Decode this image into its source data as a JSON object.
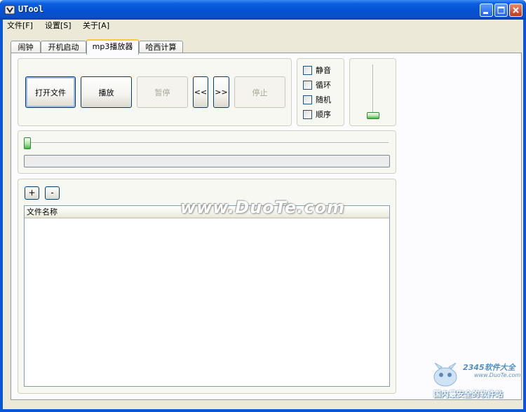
{
  "window": {
    "title": "UTool"
  },
  "menu": [
    {
      "label": "文件[F]"
    },
    {
      "label": "设置[S]"
    },
    {
      "label": "关于[A]"
    }
  ],
  "tabs": [
    {
      "label": "闹钟"
    },
    {
      "label": "开机启动"
    },
    {
      "label": "mp3播放器",
      "active": true
    },
    {
      "label": "哈西计算"
    }
  ],
  "player": {
    "open_file": "打开文件",
    "play": "播放",
    "pause": "暂停",
    "prev": "<<",
    "next": ">>",
    "stop": "停止",
    "options": [
      {
        "label": "静音",
        "checked": false
      },
      {
        "label": "循环",
        "checked": false
      },
      {
        "label": "随机",
        "checked": false
      },
      {
        "label": "顺序",
        "checked": false
      }
    ],
    "volume_level": 0,
    "seek_position": 0,
    "progress": 0
  },
  "playlist": {
    "add": "+",
    "remove": "-",
    "column_header": "文件名称",
    "items": []
  },
  "watermark": "www.DuoTe.com",
  "logo": {
    "main": "2345软件大全",
    "url": "www.DuoTe.com",
    "tagline": "国内最安全的软件站"
  }
}
